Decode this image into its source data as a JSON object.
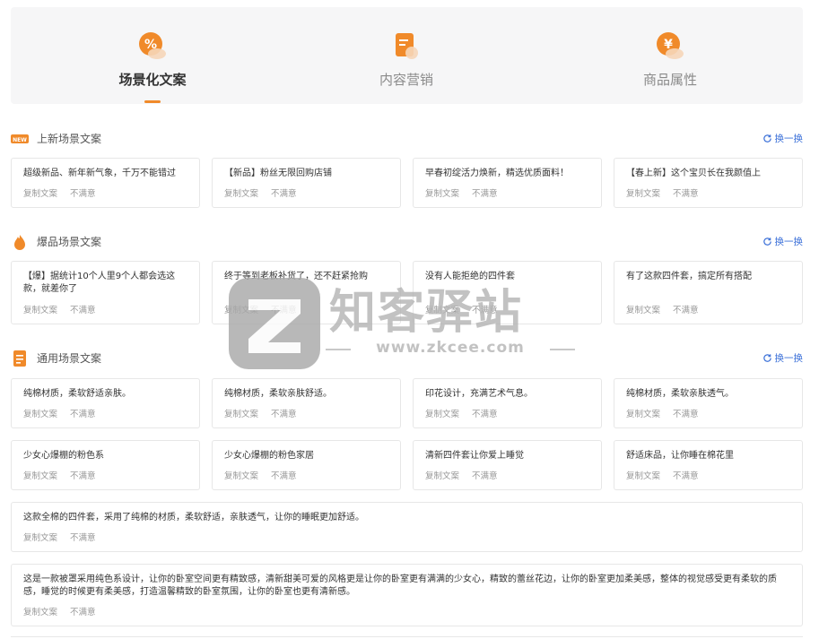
{
  "tabs": [
    {
      "label": "场景化文案",
      "icon": "percent-tag-icon",
      "active": true
    },
    {
      "label": "内容营销",
      "icon": "document-play-icon",
      "active": false
    },
    {
      "label": "商品属性",
      "icon": "yen-coin-icon",
      "active": false
    }
  ],
  "colors": {
    "accent": "#f08a2a",
    "link": "#3a6fd8",
    "border": "#e7e7e7",
    "panel": "#f6f6f7"
  },
  "swap_label": "换一换",
  "actions": {
    "copy": "复制文案",
    "dislike": "不满意"
  },
  "sections": [
    {
      "title": "上新场景文案",
      "badge": "NEW",
      "icon": "new-badge-icon",
      "cards": [
        "超级新品、新年新气象，千万不能错过",
        "【新品】粉丝无限回购店铺",
        "早春初绽活力焕新，精选优质面料！",
        "【春上新】这个宝贝长在我颜值上"
      ]
    },
    {
      "title": "爆品场景文案",
      "icon": "flame-icon",
      "cards": [
        "【爆】据统计10个人里9个人都会选这款，就差你了",
        "终于等到老板补货了，还不赶紧抢购",
        "没有人能拒绝的四件套",
        "有了这款四件套，搞定所有搭配"
      ]
    },
    {
      "title": "通用场景文案",
      "icon": "note-icon",
      "cards": [
        "纯棉材质，柔软舒适亲肤。",
        "纯棉材质，柔软亲肤舒适。",
        "印花设计，充满艺术气息。",
        "纯棉材质，柔软亲肤透气。",
        "少女心爆棚的粉色系",
        "少女心爆棚的粉色家居",
        "清新四件套让你爱上睡觉",
        "舒适床品，让你睡在棉花里"
      ],
      "wide_cards": [
        "这款全棉的四件套，采用了纯棉的材质，柔软舒适，亲肤透气，让你的睡眠更加舒适。",
        "这是一款被罩采用纯色系设计，让你的卧室空间更有精致感，清新甜美可爱的风格更是让你的卧室更有满满的少女心，精致的蕾丝花边，让你的卧室更加柔美感，整体的视觉感受更有柔软的质感，睡觉的时候更有柔美感，打造温馨精致的卧室氛围，让你的卧室也更有清新感。"
      ]
    }
  ],
  "watermark": {
    "text": "知客驿站",
    "url": "www.zkcee.com"
  }
}
